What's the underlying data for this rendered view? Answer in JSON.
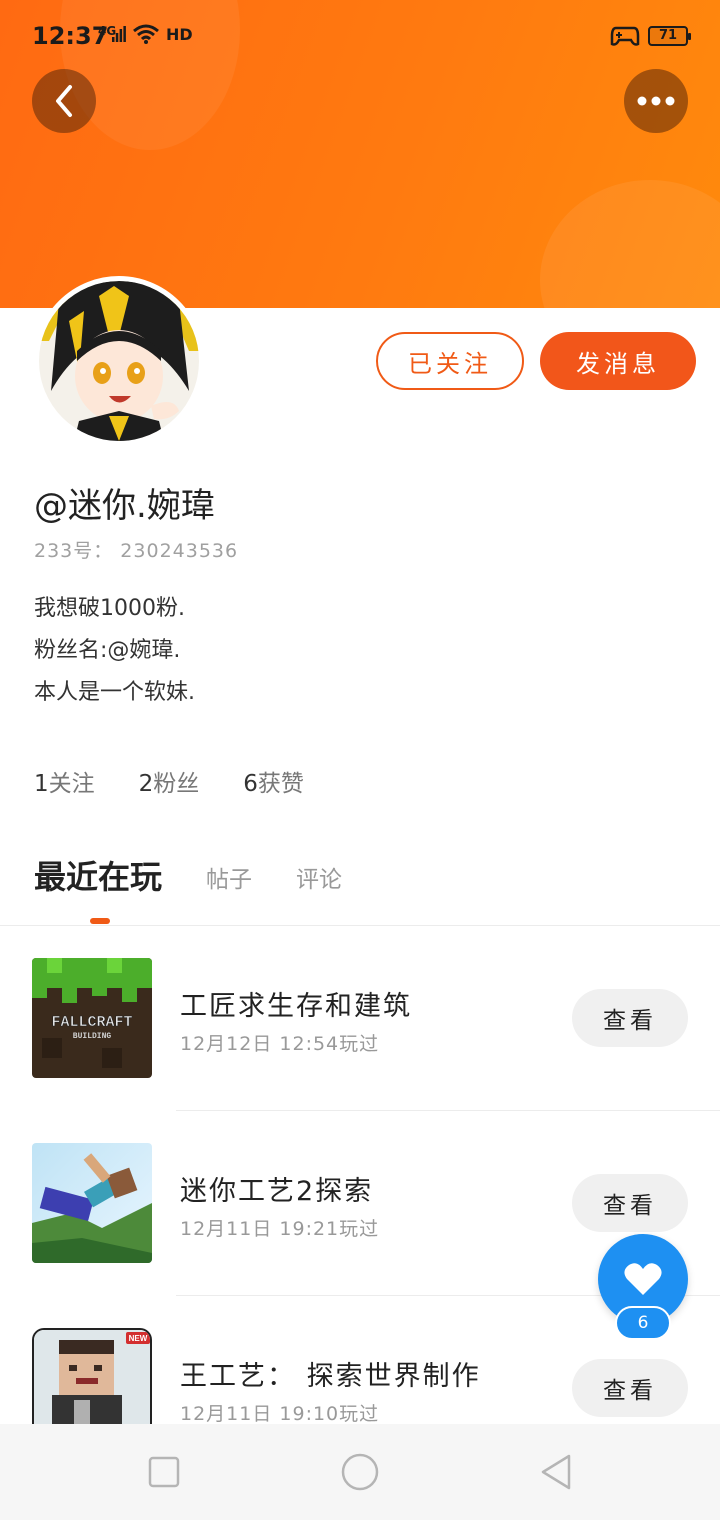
{
  "status_bar": {
    "time": "12:37",
    "network": "4G",
    "hd": "HD",
    "battery": "71"
  },
  "profile": {
    "username": "@迷你.婉瑋",
    "uid": "233号： 230243536",
    "bio": [
      "我想破1000粉.",
      "粉丝名:@婉瑋.",
      "本人是一个软妹."
    ],
    "follow_button": "已关注",
    "message_button": "发消息",
    "stats": [
      {
        "num": "1",
        "label": "关注"
      },
      {
        "num": "2",
        "label": "粉丝"
      },
      {
        "num": "6",
        "label": "获赞"
      }
    ]
  },
  "tabs": [
    {
      "label": "最近在玩",
      "active": true
    },
    {
      "label": "帖子",
      "active": false
    },
    {
      "label": "评论",
      "active": false
    }
  ],
  "games": [
    {
      "name": "工匠求生存和建筑",
      "time": "12月12日 12:54玩过",
      "view": "查看"
    },
    {
      "name": "迷你工艺2探索",
      "time": "12月11日 19:21玩过",
      "view": "查看"
    },
    {
      "name": "王工艺： 探索世界制作",
      "time": "12月11日 19:10玩过",
      "view": "查看"
    }
  ],
  "thumb_texts": {
    "fallcraft": "FALLCRAFT",
    "building": "BUILDING",
    "new_badge": "NEW"
  },
  "like": {
    "count": "6"
  },
  "colors": {
    "accent": "#f2561a",
    "banner": "#ff7a10",
    "like": "#1e90f2"
  }
}
